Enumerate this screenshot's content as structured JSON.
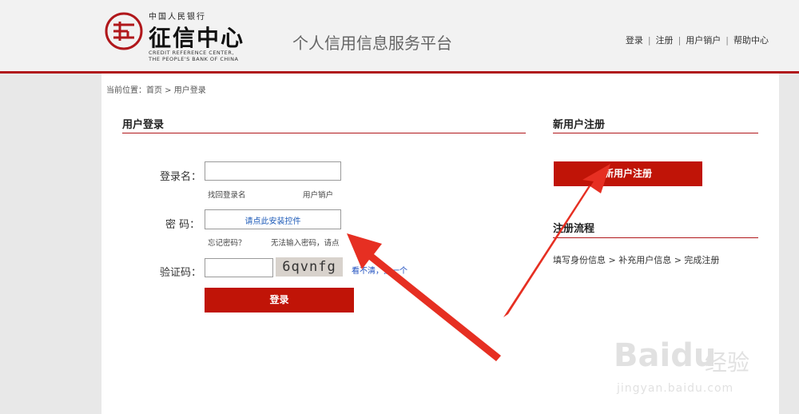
{
  "header": {
    "logo_top": "中国人民银行",
    "logo_main": "征信中心",
    "logo_en1": "CREDIT REFERENCE CENTER,",
    "logo_en2": "THE PEOPLE'S BANK OF CHINA",
    "platform_title": "个人信用信息服务平台",
    "nav": [
      "登录",
      "注册",
      "用户销户",
      "帮助中心"
    ],
    "accent_color": "#b0171b"
  },
  "breadcrumb": "当前位置：首页 > 用户登录",
  "login": {
    "title": "用户登录",
    "username_label": "登录名：",
    "username_value": "",
    "find_username": "找回登录名",
    "cancel_account": "用户销户",
    "password_label": "密 码：",
    "install_control": "请点此安装控件",
    "forgot_password": "忘记密码？",
    "cannot_input": "无法输入密码，请点",
    "captcha_label": "验证码：",
    "captcha_value": "",
    "captcha_text": "6qvnfg",
    "refresh_captcha": "看不清，换一个",
    "login_button": "登录"
  },
  "register": {
    "title": "新用户注册",
    "button": "新用户注册",
    "flow_title": "注册流程",
    "flow_steps": "填写身份信息 > 补充用户信息 > 完成注册"
  },
  "watermark": {
    "main": "Baidu",
    "cn": "经验",
    "url": "jingyan.baidu.com"
  }
}
